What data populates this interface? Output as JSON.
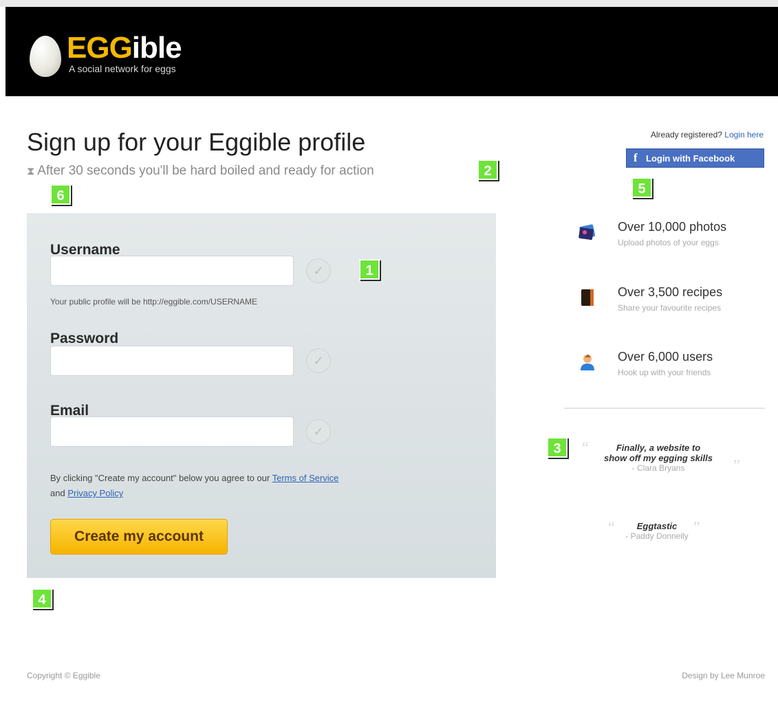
{
  "header": {
    "logo_egg": "EGG",
    "logo_ible": "ible",
    "tagline": "A social network for eggs"
  },
  "main": {
    "title": "Sign up for your Eggible profile",
    "subtitle": "After 30 seconds you'll be hard boiled and ready for action"
  },
  "form": {
    "username_label": "Username",
    "username_value": "",
    "username_hint": "Your public profile will be http://eggible.com/USERNAME",
    "password_label": "Password",
    "password_value": "",
    "email_label": "Email",
    "email_value": "",
    "terms_prefix": "By clicking \"Create my account\" below you agree to our",
    "terms_link": "Terms of Service",
    "terms_and": "and",
    "privacy_link": "Privacy Policy",
    "submit_label": "Create my account"
  },
  "sidebar": {
    "already_text": "Already registered?",
    "login_link": "Login here",
    "facebook_label": "Login with Facebook",
    "stats": [
      {
        "title": "Over 10,000 photos",
        "subtitle": "Upload photos of your eggs",
        "icon": "photos-icon"
      },
      {
        "title": "Over 3,500 recipes",
        "subtitle": "Share your favourite recipes",
        "icon": "recipe-book-icon"
      },
      {
        "title": "Over 6,000 users",
        "subtitle": "Hook up with your friends",
        "icon": "user-icon"
      }
    ],
    "quotes": [
      {
        "line1": "Finally, a website to",
        "line2": "show off my egging skills",
        "author": "- Clara Bryans"
      },
      {
        "line1": "Eggtastic",
        "author": "- Paddy Donnelly"
      }
    ]
  },
  "badges": [
    "1",
    "2",
    "3",
    "4",
    "5",
    "6"
  ],
  "footer": {
    "copyright": "Copyright © Eggible",
    "credit": "Design by Lee Munroe"
  },
  "colors": {
    "header_bg": "#000000",
    "logo_accent": "#f5b800",
    "button_yellow": "#f5b300",
    "facebook_blue": "#4a70c2",
    "link_blue": "#2f63b5",
    "badge_green": "#6ee33a"
  }
}
